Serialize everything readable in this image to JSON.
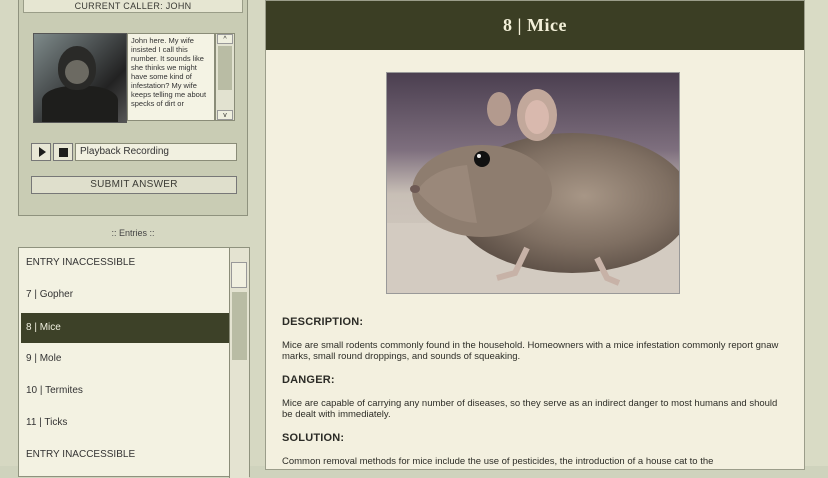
{
  "caller": {
    "title": "CURRENT CALLER: JOHN",
    "transcript": "John here. My wife insisted I call this number. It sounds like she thinks we might have some kind of infestation? My wife keeps telling me about specks of dirt or",
    "scroll_up": "^",
    "scroll_down": "v"
  },
  "playback": {
    "field_text": "Playback Recording"
  },
  "submit": {
    "label": "SUBMIT ANSWER"
  },
  "entries": {
    "label": ":: Entries ::",
    "items": [
      {
        "label": "ENTRY INACCESSIBLE"
      },
      {
        "label": "7 | Gopher"
      },
      {
        "label": "8 | Mice"
      },
      {
        "label": "9 | Mole"
      },
      {
        "label": "10 | Termites"
      },
      {
        "label": "11 | Ticks"
      },
      {
        "label": "ENTRY INACCESSIBLE"
      }
    ],
    "selected_index": 2
  },
  "article": {
    "title": "8 | Mice",
    "description_label": "DESCRIPTION:",
    "description": "Mice are small rodents commonly found in the household. Homeowners with a mice infestation commonly report gnaw marks, small round droppings, and sounds of squeaking.",
    "danger_label": "DANGER:",
    "danger": "Mice are capable of carrying any number of diseases, so they serve as an indirect danger to most humans and should be dealt with immediately.",
    "solution_label": "SOLUTION:",
    "solution": "Common removal methods for mice include the use of pesticides, the introduction of a house cat to the"
  },
  "colors": {
    "header_bg": "#3b3e24",
    "selected_bg": "#3d4128",
    "page_bg": "#f3f0df"
  }
}
